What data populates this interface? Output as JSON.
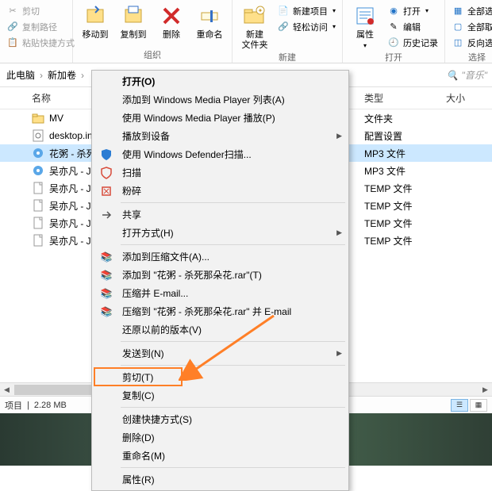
{
  "ribbon": {
    "clipboard": {
      "cut": "剪切",
      "copy_path": "复制路径",
      "paste_shortcut": "粘贴快捷方式"
    },
    "organize": {
      "move_to": "移动到",
      "copy_to": "复制到",
      "delete": "删除",
      "rename": "重命名",
      "label": "组织"
    },
    "new": {
      "new_folder": "新建\n文件夹",
      "new_item": "新建项目",
      "easy_access": "轻松访问",
      "label": "新建"
    },
    "open": {
      "properties": "属性",
      "open": "打开",
      "edit": "编辑",
      "history": "历史记录",
      "label": "打开"
    },
    "select": {
      "select_all": "全部选择",
      "select_none": "全部取消",
      "invert": "反向选择",
      "label": "选择"
    }
  },
  "breadcrumb": {
    "c1": "此电脑",
    "c2": "新加卷",
    "search_placeholder": "\"音乐\""
  },
  "columns": {
    "name": "名称",
    "type": "类型",
    "size": "大小"
  },
  "files": [
    {
      "name": "MV",
      "type": "文件夹",
      "icon": "folder"
    },
    {
      "name": "desktop.ini",
      "type": "配置设置",
      "icon": "ini"
    },
    {
      "name": "花粥 - 杀死那朵花",
      "type": "MP3 文件",
      "icon": "mp3",
      "selected": true
    },
    {
      "name": "吴亦凡 - JU",
      "type": "MP3 文件",
      "icon": "mp3"
    },
    {
      "name": "吴亦凡 - JU",
      "type": "TEMP 文件",
      "icon": "file"
    },
    {
      "name": "吴亦凡 - JU",
      "type": "TEMP 文件",
      "icon": "file"
    },
    {
      "name": "吴亦凡 - JU",
      "type": "TEMP 文件",
      "icon": "file"
    },
    {
      "name": "吴亦凡 - JU",
      "type": "TEMP 文件",
      "icon": "file"
    }
  ],
  "status": {
    "selection": "项目",
    "size": "2.28 MB"
  },
  "context_menu": {
    "open": "打开(O)",
    "add_wmp": "添加到 Windows Media Player 列表(A)",
    "play_wmp": "使用 Windows Media Player 播放(P)",
    "cast": "播放到设备",
    "defender": "使用 Windows Defender扫描...",
    "scan": "扫描",
    "shred": "粉碎",
    "share": "共享",
    "open_with": "打开方式(H)",
    "add_archive": "添加到压缩文件(A)...",
    "add_to_rar": "添加到 \"花粥 - 杀死那朵花.rar\"(T)",
    "compress_email": "压缩并 E-mail...",
    "compress_rar_email": "压缩到 \"花粥 - 杀死那朵花.rar\" 并 E-mail",
    "previous_versions": "还原以前的版本(V)",
    "send_to": "发送到(N)",
    "cut": "剪切(T)",
    "copy": "复制(C)",
    "create_shortcut": "创建快捷方式(S)",
    "delete": "删除(D)",
    "rename": "重命名(M)",
    "properties": "属性(R)"
  }
}
